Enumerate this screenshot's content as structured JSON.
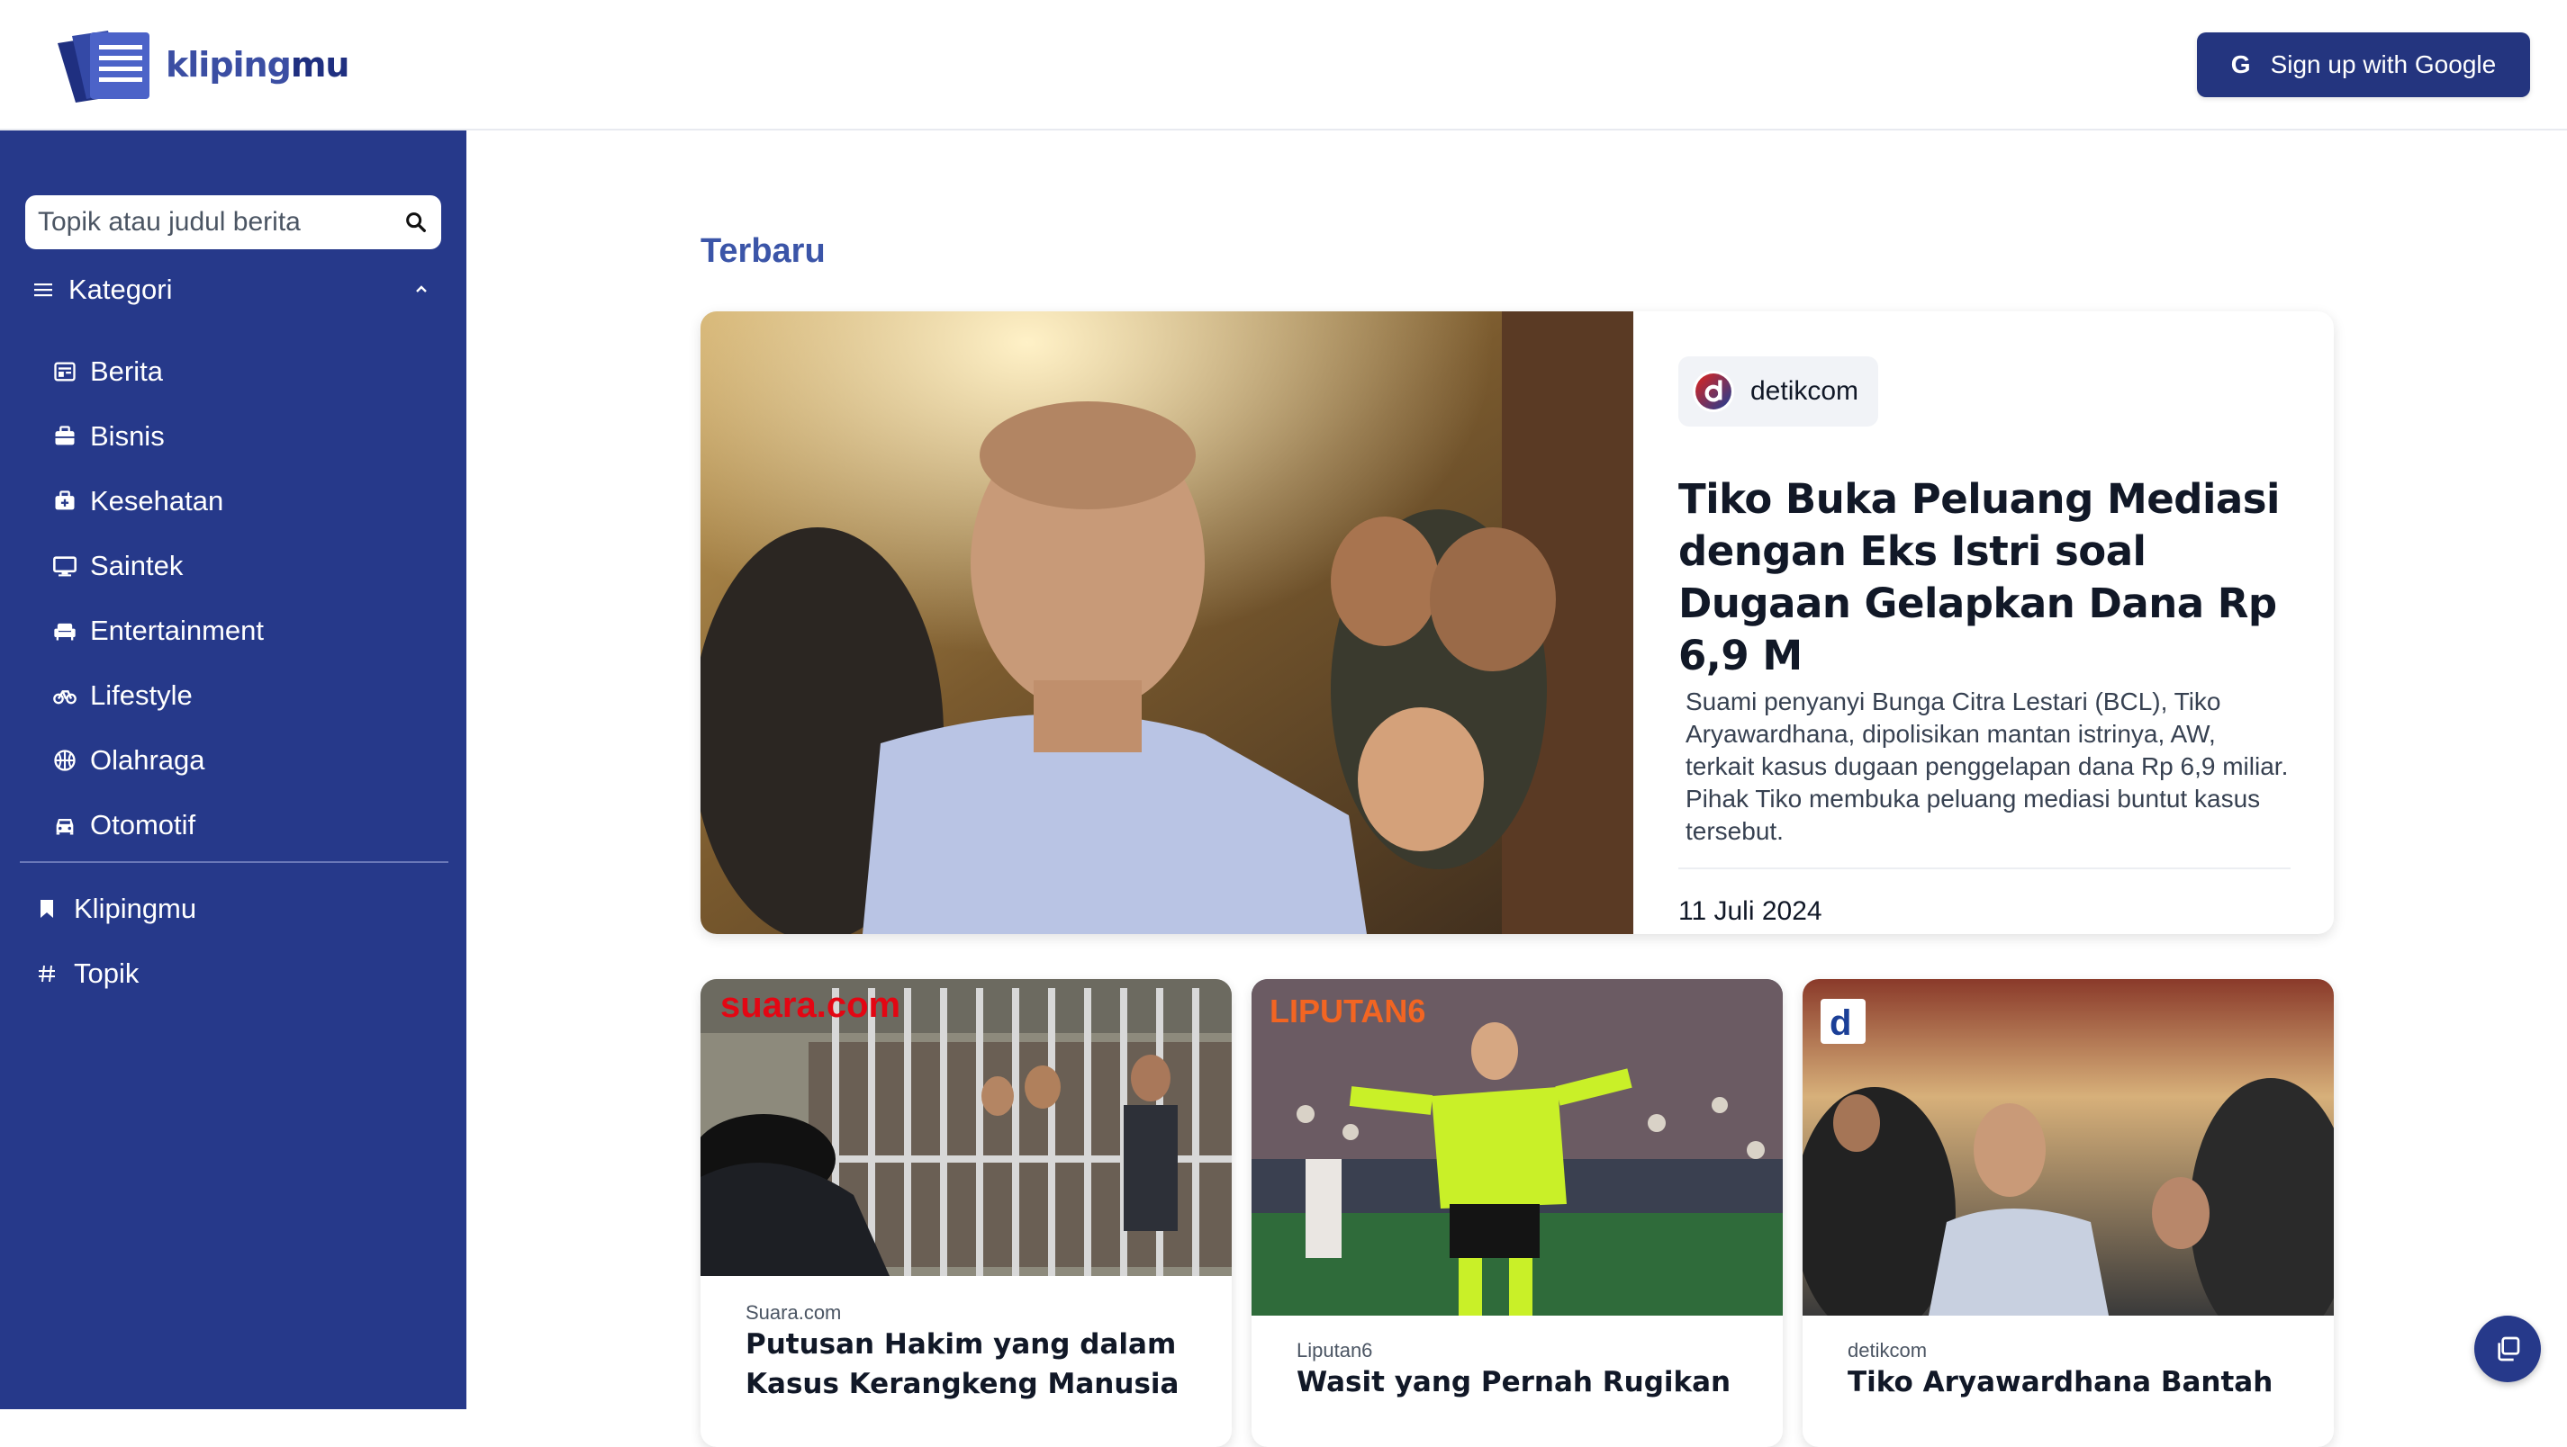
{
  "header": {
    "logo_part1": "kliping",
    "logo_part2": "mu",
    "signup_label": "Sign up with Google",
    "signup_icon_letter": "G"
  },
  "sidebar": {
    "search_placeholder": "Topik atau judul berita",
    "category_heading": "Kategori",
    "categories": [
      {
        "label": "Berita",
        "icon": "newspaper-icon"
      },
      {
        "label": "Bisnis",
        "icon": "briefcase-icon"
      },
      {
        "label": "Kesehatan",
        "icon": "medical-kit-icon"
      },
      {
        "label": "Saintek",
        "icon": "monitor-icon"
      },
      {
        "label": "Entertainment",
        "icon": "sofa-icon"
      },
      {
        "label": "Lifestyle",
        "icon": "bike-icon"
      },
      {
        "label": "Olahraga",
        "icon": "basketball-icon"
      },
      {
        "label": "Otomotif",
        "icon": "car-icon"
      }
    ],
    "links": [
      {
        "label": "Klipingmu",
        "icon": "bookmark-icon"
      },
      {
        "label": "Topik",
        "icon": "hashtag-icon"
      }
    ]
  },
  "main": {
    "section_title": "Terbaru",
    "featured": {
      "source": "detikcom",
      "title": "Tiko Buka Peluang Mediasi dengan Eks Istri soal Dugaan Gelapkan Dana Rp 6,9 M",
      "summary": "Suami penyanyi Bunga Citra Lestari (BCL), Tiko Aryawardhana, dipolisikan mantan istrinya, AW, terkait kasus dugaan penggelapan dana Rp 6,9 miliar. Pihak Tiko membuka peluang mediasi buntut kasus tersebut.",
      "date": "11 Juli 2024"
    },
    "cards": [
      {
        "source": "Suara.com",
        "title": "Putusan Hakim yang dalam Kasus Kerangkeng Manusia",
        "image_watermark": "suara.com"
      },
      {
        "source": "Liputan6",
        "title": "Wasit yang Pernah Rugikan",
        "image_watermark": "LIPUTAN6"
      },
      {
        "source": "detikcom",
        "title": "Tiko Aryawardhana Bantah",
        "image_watermark": "d"
      }
    ]
  },
  "colors": {
    "brand_navy": "#26398a",
    "accent_blue": "#3b55a8",
    "button_navy": "#24357f"
  }
}
